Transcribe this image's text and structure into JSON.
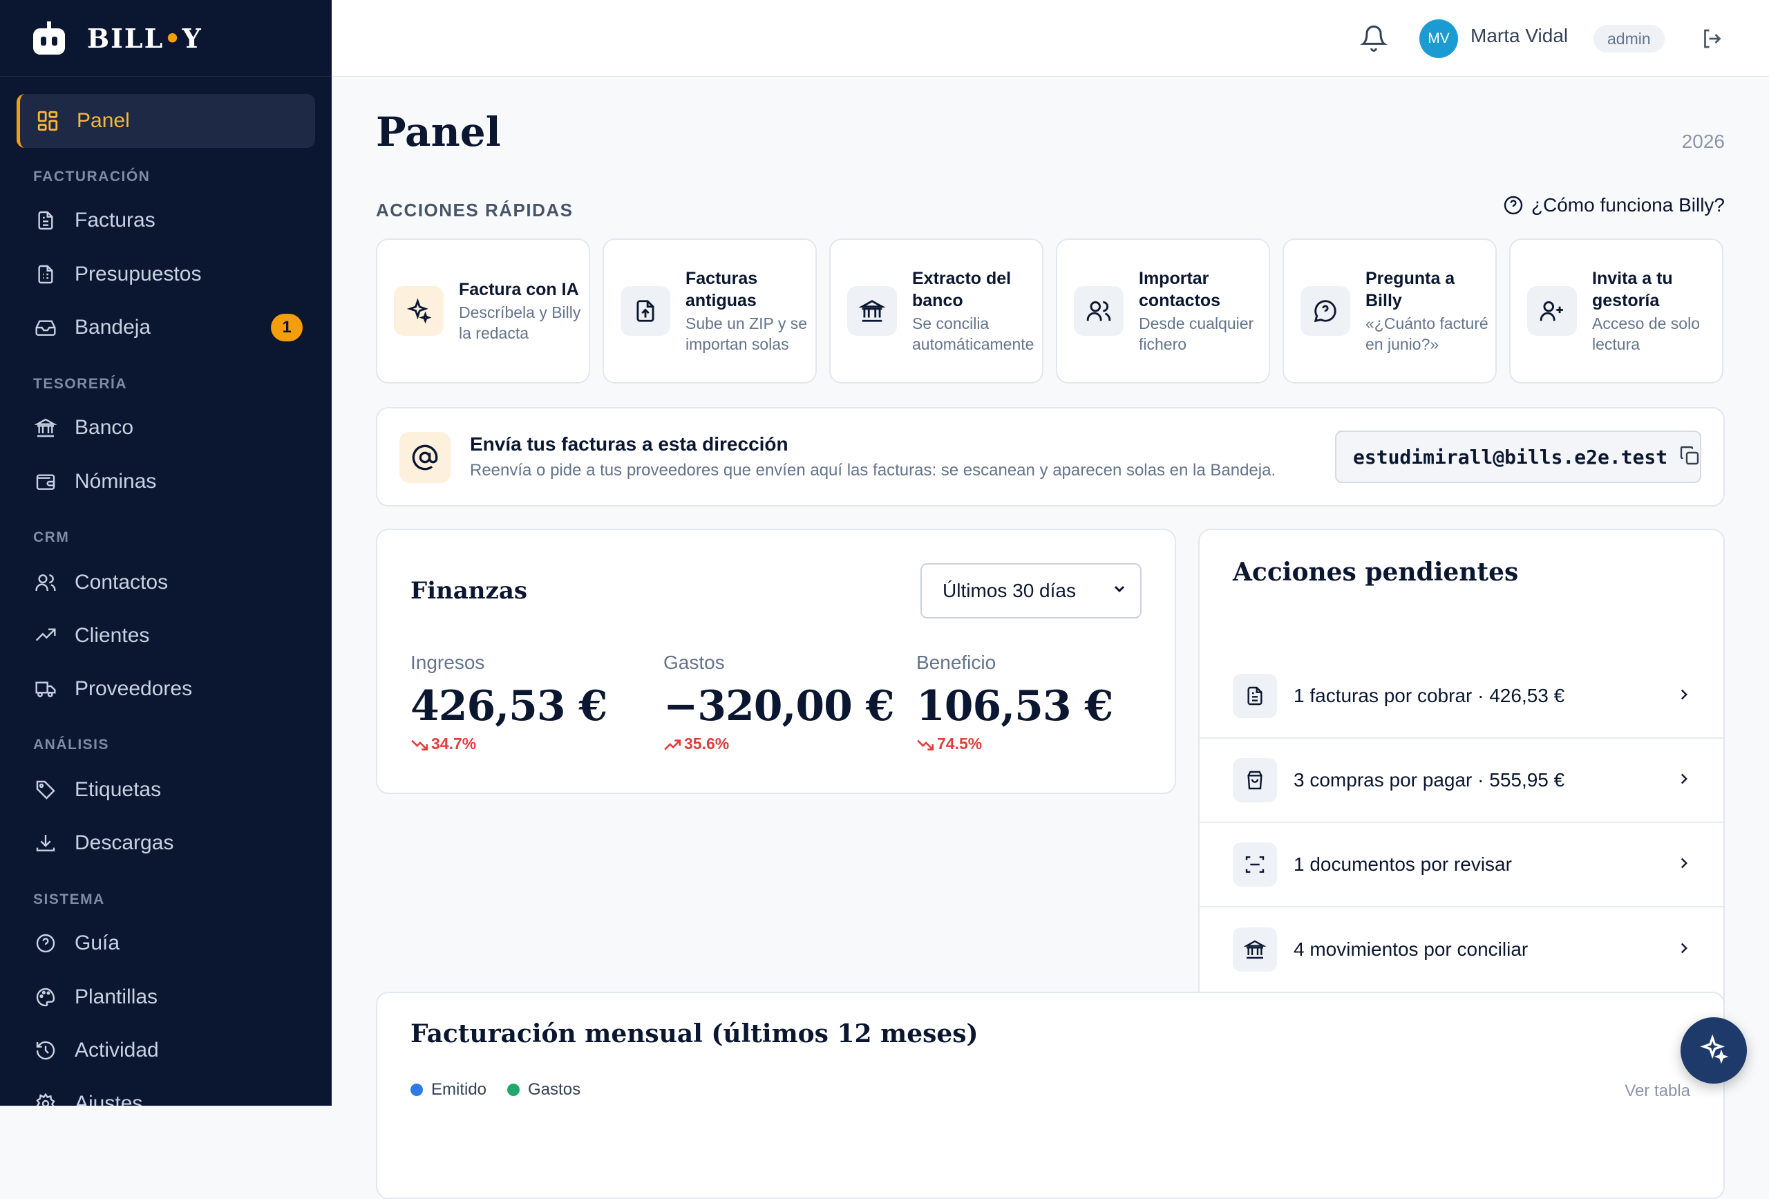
{
  "brand": {
    "name_left": "BILL",
    "name_dot": "•",
    "name_right": "Y"
  },
  "sidebar": {
    "active": "Panel",
    "sections": [
      {
        "title": "FACTURACIÓN",
        "items": [
          {
            "label": "Facturas"
          },
          {
            "label": "Presupuestos"
          },
          {
            "label": "Bandeja",
            "badge": "1"
          }
        ]
      },
      {
        "title": "TESORERÍA",
        "items": [
          {
            "label": "Banco"
          },
          {
            "label": "Nóminas"
          }
        ]
      },
      {
        "title": "CRM",
        "items": [
          {
            "label": "Contactos"
          },
          {
            "label": "Clientes"
          },
          {
            "label": "Proveedores"
          }
        ]
      },
      {
        "title": "ANÁLISIS",
        "items": [
          {
            "label": "Etiquetas"
          },
          {
            "label": "Descargas"
          }
        ]
      },
      {
        "title": "SISTEMA",
        "items": [
          {
            "label": "Guía"
          },
          {
            "label": "Plantillas"
          },
          {
            "label": "Actividad"
          },
          {
            "label": "Ajustes"
          }
        ]
      }
    ]
  },
  "topbar": {
    "initials": "MV",
    "username": "Marta Vidal",
    "role": "admin"
  },
  "page": {
    "title": "Panel",
    "year": "2026"
  },
  "quick_actions": {
    "label": "ACCIONES RÁPIDAS",
    "help": "¿Cómo funciona Billy?",
    "items": [
      {
        "title": "Factura con IA",
        "sub": "Descríbela y Billy la redacta",
        "icon": "sparkles-icon"
      },
      {
        "title": "Facturas antiguas",
        "sub": "Sube un ZIP y se importan solas",
        "icon": "file-upload-icon"
      },
      {
        "title": "Extracto del banco",
        "sub": "Se concilia automáticamente",
        "icon": "bank-icon"
      },
      {
        "title": "Importar contactos",
        "sub": "Desde cualquier fichero",
        "icon": "users-icon"
      },
      {
        "title": "Pregunta a Billy",
        "sub": "«¿Cuánto facturé en junio?»",
        "icon": "chat-question-icon"
      },
      {
        "title": "Invita a tu gestoría",
        "sub": "Acceso de solo lectura",
        "icon": "user-plus-icon"
      }
    ]
  },
  "email": {
    "title": "Envía tus facturas a esta dirección",
    "sub": "Reenvía o pide a tus proveedores que envíen aquí las facturas: se escanean y aparecen solas en la Bandeja.",
    "address": "estudimirall@bills.e2e.test"
  },
  "finanzas": {
    "title": "Finanzas",
    "period": "Últimos 30 días",
    "metrics": [
      {
        "label": "Ingresos",
        "value": "426,53 €",
        "change": "34.7%",
        "trend": "down"
      },
      {
        "label": "Gastos",
        "value": "−320,00 €",
        "change": "35.6%",
        "trend": "up"
      },
      {
        "label": "Beneficio",
        "value": "106,53 €",
        "change": "74.5%",
        "trend": "down"
      }
    ],
    "change_color": "#e23d3d"
  },
  "pendientes": {
    "title": "Acciones pendientes",
    "items": [
      {
        "text": "1 facturas por cobrar · 426,53 €",
        "icon": "document-icon"
      },
      {
        "text": "3 compras por pagar · 555,95 €",
        "icon": "shopping-bag-icon"
      },
      {
        "text": "1 documentos por revisar",
        "icon": "scan-icon"
      },
      {
        "text": "4 movimientos por conciliar",
        "icon": "bank-icon"
      }
    ]
  },
  "chart": {
    "title": "Facturación mensual (últimos 12 meses)",
    "legend": [
      {
        "name": "Emitido",
        "color": "#2f7be5"
      },
      {
        "name": "Gastos",
        "color": "#1faa6b"
      }
    ],
    "link": "Ver tabla"
  },
  "colors": {
    "accent": "#f59e0b",
    "sidebar_bg": "#0b1730",
    "avatar": "#1b9bd1"
  }
}
